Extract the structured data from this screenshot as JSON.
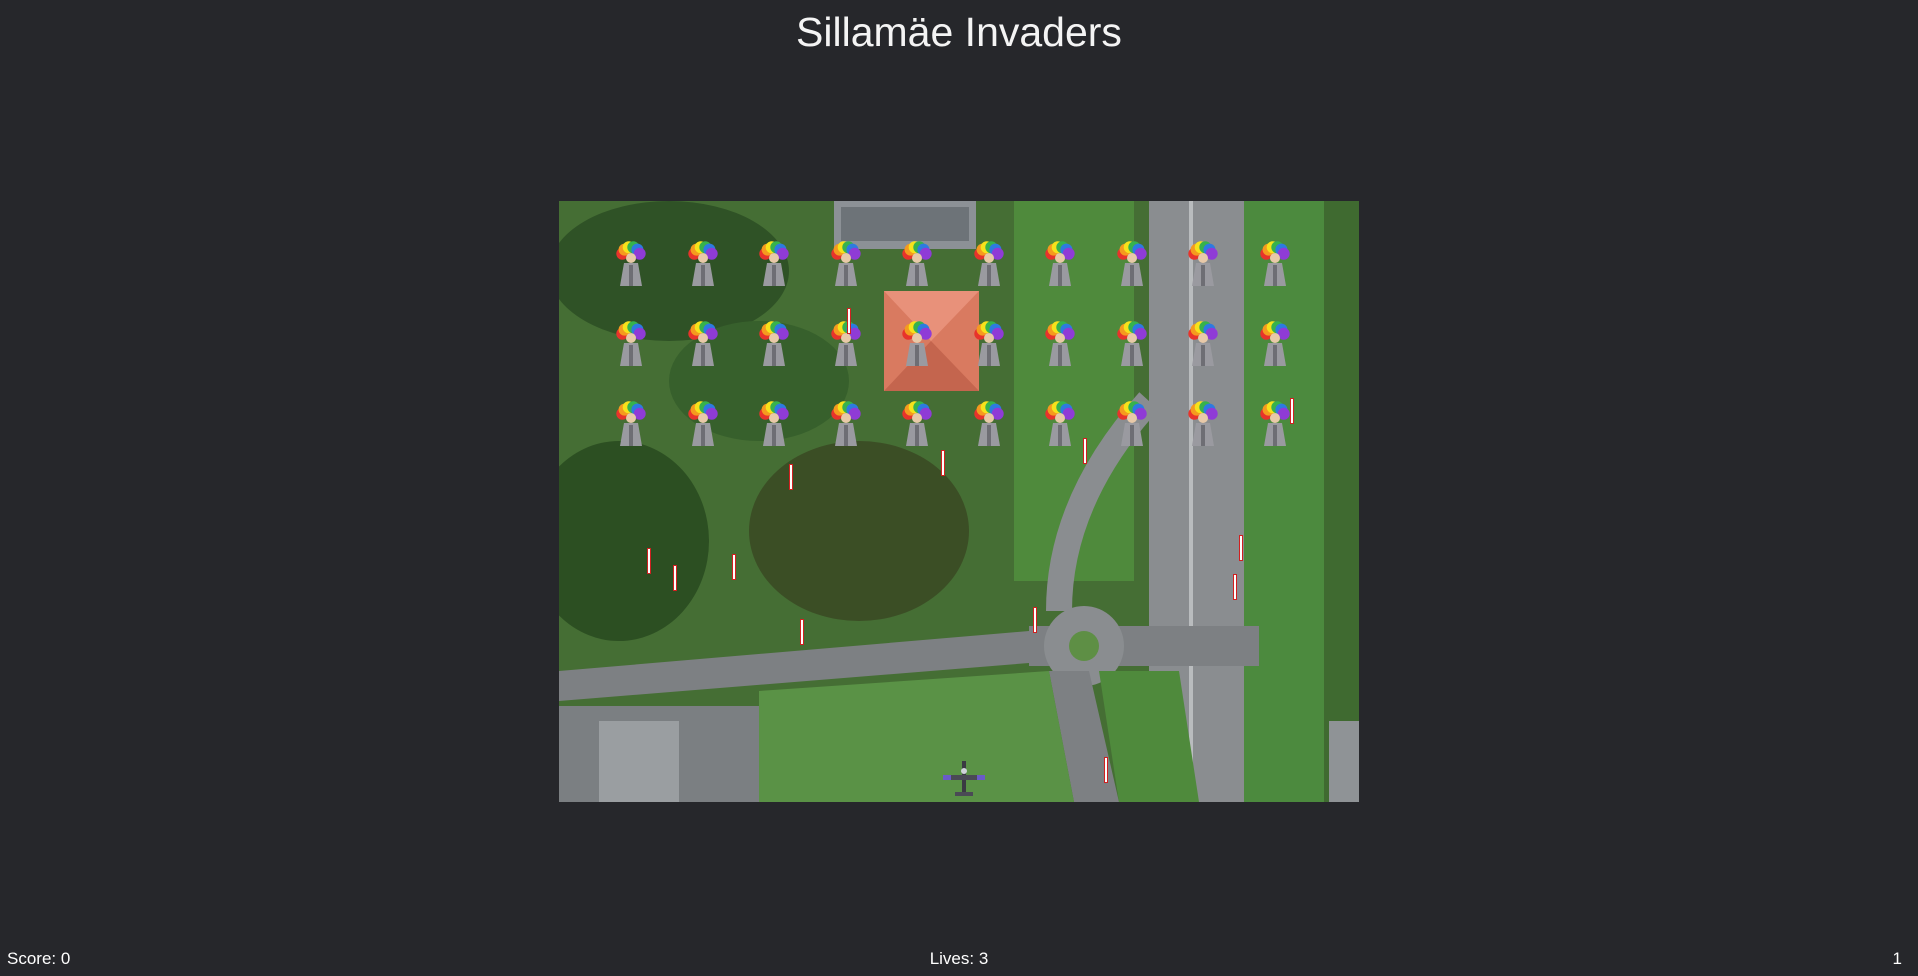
{
  "title": "Sillamäe Invaders",
  "hud": {
    "score": "Score: 0",
    "lives": "Lives: 3",
    "level": "1"
  },
  "enemies": {
    "rows": 3,
    "columns": 10,
    "icon": "rainbow-haired-invader-icon"
  },
  "player": {
    "icon": "fighter-plane-icon"
  },
  "bullet_count": 15,
  "colors": {
    "page_background": "#26272b",
    "bullet_fill": "#ffffff",
    "bullet_outline": "#d02020"
  }
}
